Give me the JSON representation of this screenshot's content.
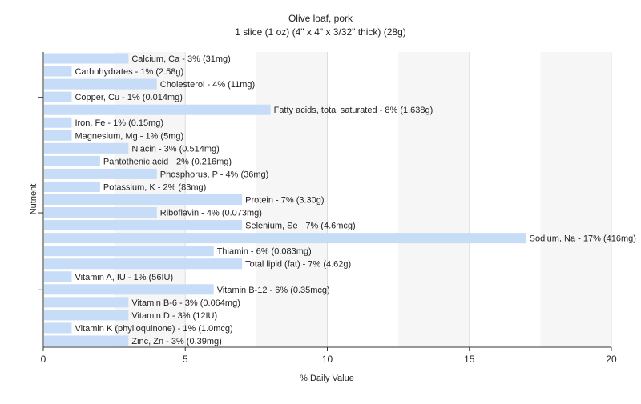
{
  "chart_data": {
    "type": "bar",
    "orientation": "horizontal",
    "title": "Olive loaf, pork",
    "subtitle": "1 slice (1 oz) (4\" x 4\" x 3/32\" thick) (28g)",
    "xlabel": "% Daily Value",
    "ylabel": "Nutrient",
    "xlim": [
      0,
      20
    ],
    "xticks": [
      0,
      5,
      10,
      15,
      20
    ],
    "grid": true,
    "bar_color": "#c6dcf7",
    "categories": [
      "Calcium, Ca",
      "Carbohydrates",
      "Cholesterol",
      "Copper, Cu",
      "Fatty acids, total saturated",
      "Iron, Fe",
      "Magnesium, Mg",
      "Niacin",
      "Pantothenic acid",
      "Phosphorus, P",
      "Potassium, K",
      "Protein",
      "Riboflavin",
      "Selenium, Se",
      "Sodium, Na",
      "Thiamin",
      "Total lipid (fat)",
      "Vitamin A, IU",
      "Vitamin B-12",
      "Vitamin B-6",
      "Vitamin D",
      "Vitamin K (phylloquinone)",
      "Zinc, Zn"
    ],
    "values": [
      3,
      1,
      4,
      1,
      8,
      1,
      1,
      3,
      2,
      4,
      2,
      7,
      4,
      7,
      17,
      6,
      7,
      1,
      6,
      3,
      3,
      1,
      3
    ],
    "labels": [
      "Calcium, Ca - 3% (31mg)",
      "Carbohydrates - 1% (2.58g)",
      "Cholesterol - 4% (11mg)",
      "Copper, Cu - 1% (0.014mg)",
      "Fatty acids, total saturated - 8% (1.638g)",
      "Iron, Fe - 1% (0.15mg)",
      "Magnesium, Mg - 1% (5mg)",
      "Niacin - 3% (0.514mg)",
      "Pantothenic acid - 2% (0.216mg)",
      "Phosphorus, P - 4% (36mg)",
      "Potassium, K - 2% (83mg)",
      "Protein - 7% (3.30g)",
      "Riboflavin - 4% (0.073mg)",
      "Selenium, Se - 7% (4.6mcg)",
      "Sodium, Na - 17% (416mg)",
      "Thiamin - 6% (0.083mg)",
      "Total lipid (fat) - 7% (4.62g)",
      "Vitamin A, IU - 1% (56IU)",
      "Vitamin B-12 - 6% (0.35mcg)",
      "Vitamin B-6 - 3% (0.064mg)",
      "Vitamin D - 3% (12IU)",
      "Vitamin K (phylloquinone) - 1% (1.0mcg)",
      "Zinc, Zn - 3% (0.39mg)"
    ]
  }
}
